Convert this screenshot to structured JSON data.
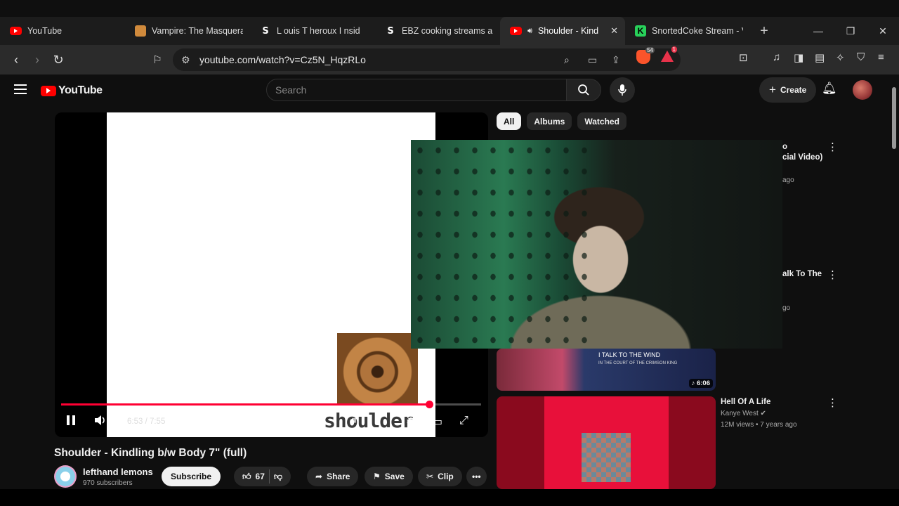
{
  "browser": {
    "tabs": [
      {
        "label": "YouTube",
        "icon": "youtube-icon"
      },
      {
        "label": "Vampire: The Masquerade",
        "icon": "vampire-icon"
      },
      {
        "label": "L ouis T heroux I nsid",
        "icon": "s-icon"
      },
      {
        "label": "EBZ cooking streams are",
        "icon": "s-icon"
      },
      {
        "label": "Shoulder - Kindl",
        "icon": "youtube-icon",
        "active": true
      },
      {
        "label": "SnortedCoke Stream - V",
        "icon": "kick-icon"
      }
    ],
    "url": "youtube.com/watch?v=Cz5N_HqzRLo",
    "brave_badge": "54",
    "rewards_badge": "1"
  },
  "youtube": {
    "logo": "YouTube",
    "search_placeholder": "Search",
    "create_label": "Create"
  },
  "player": {
    "time": "6:53 / 7:55",
    "progress": 0.877,
    "overlay_text": "shoulder"
  },
  "video": {
    "title": "Shoulder - Kindling b/w Body 7\" (full)",
    "channel": "lefthand lemons",
    "subscribers": "970 subscribers",
    "subscribe_label": "Subscribe",
    "likes": "67",
    "share_label": "Share",
    "save_label": "Save",
    "clip_label": "Clip"
  },
  "chips": [
    "All",
    "Albums",
    "Watched"
  ],
  "sidebar": {
    "items": [
      {
        "title_fragment": "o",
        "title_fragment2": "cial Video)",
        "meta_fragment": "ago"
      },
      {
        "title_fragment": "alk To The",
        "meta_fragment": "go"
      },
      {
        "thumb_line1": "I TALK TO THE WIND",
        "thumb_line2": "IN THE COURT OF THE CRIMSON KING",
        "duration": "♪ 6:06"
      },
      {
        "title": "Hell Of A Life",
        "channel": "Kanye West",
        "meta": "12M views • 7 years ago"
      }
    ]
  }
}
